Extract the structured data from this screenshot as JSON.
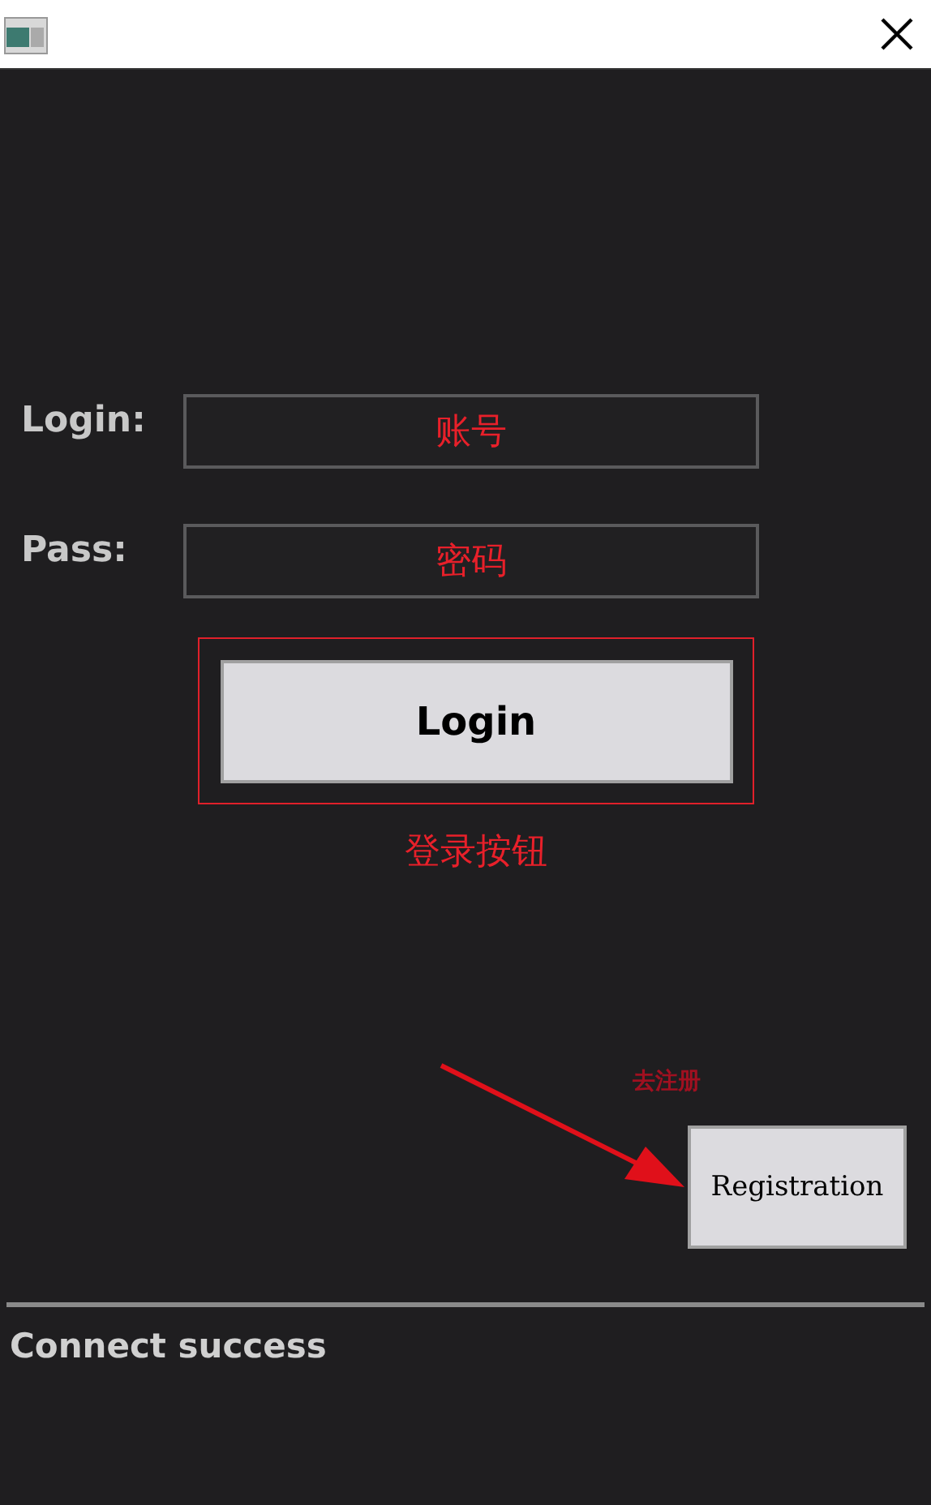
{
  "fields": [
    {
      "label": "Login:",
      "annotation": "账号"
    },
    {
      "label": "Pass:",
      "annotation": "密码"
    }
  ],
  "login_button": {
    "label": "Login",
    "annotation": "登录按钮"
  },
  "registration_button": {
    "label": "Registration",
    "annotation": "去注册"
  },
  "status": "Connect success"
}
